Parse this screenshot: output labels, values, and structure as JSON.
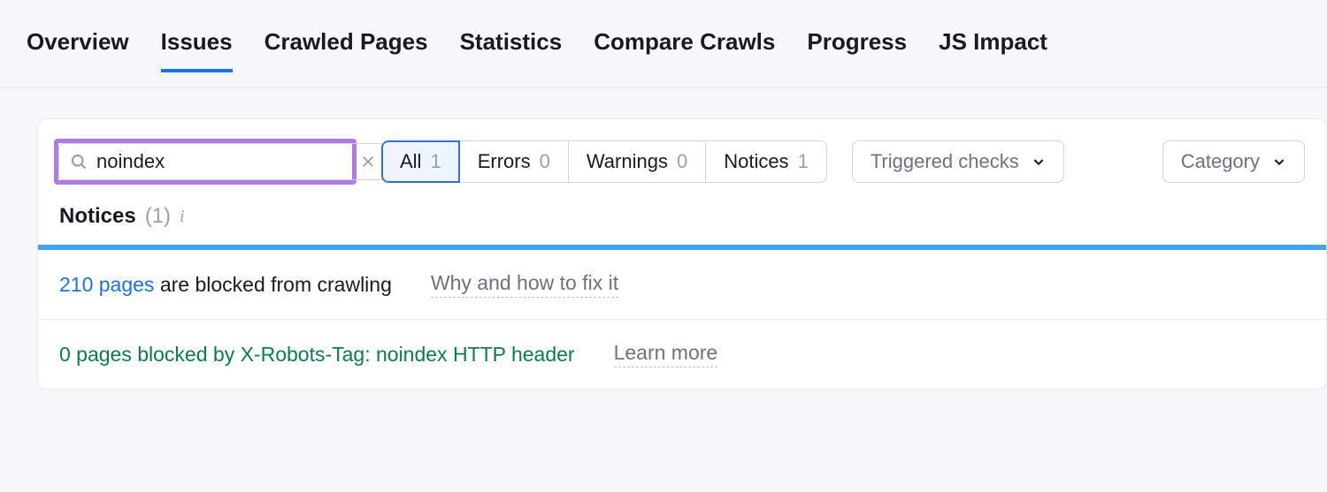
{
  "tabs": {
    "overview": "Overview",
    "issues": "Issues",
    "crawled_pages": "Crawled Pages",
    "statistics": "Statistics",
    "compare_crawls": "Compare Crawls",
    "progress": "Progress",
    "js_impact": "JS Impact",
    "active": "issues"
  },
  "search": {
    "value": "noindex"
  },
  "filters": {
    "all": {
      "label": "All",
      "count": "1"
    },
    "errors": {
      "label": "Errors",
      "count": "0"
    },
    "warnings": {
      "label": "Warnings",
      "count": "0"
    },
    "notices": {
      "label": "Notices",
      "count": "1"
    },
    "selected": "all"
  },
  "dropdowns": {
    "triggered_checks": "Triggered checks",
    "category": "Category"
  },
  "section": {
    "title": "Notices",
    "count": "(1)"
  },
  "rows": {
    "r1": {
      "link": "210 pages",
      "rest": " are blocked from crawling",
      "help": "Why and how to fix it"
    },
    "r2": {
      "text": "0 pages blocked by X-Robots-Tag: noindex HTTP header",
      "help": "Learn more"
    }
  }
}
